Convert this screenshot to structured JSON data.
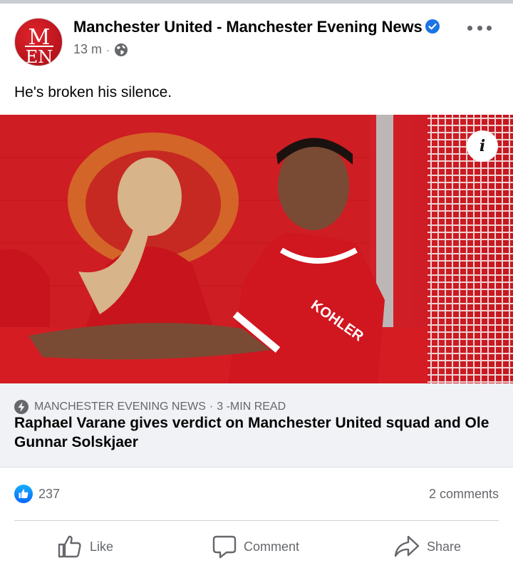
{
  "post": {
    "page_name": "Manchester United - Manchester Evening News",
    "avatar_letters": "MEN",
    "time": "13 m",
    "separator": "·",
    "privacy_icon": "globe-icon",
    "verified_icon": "verified-badge-icon",
    "more_icon": "more-options-icon",
    "text": "He's broken his silence."
  },
  "preview": {
    "info_icon": "info-icon",
    "info_glyph": "i",
    "source_icon": "instant-article-bolt-icon",
    "source": "MANCHESTER EVENING NEWS",
    "source_dot": "·",
    "read_time": "3 -MIN READ",
    "headline": "Raphael Varane gives verdict on Manchester United squad and Ole Gunnar Solskjaer",
    "image_text": {
      "shirt_sponsor": "KOHLER"
    }
  },
  "engagement": {
    "like_icon": "thumbs-up-icon",
    "likes": "237",
    "comments": "2 comments"
  },
  "actions": {
    "like_label": "Like",
    "comment_label": "Comment",
    "share_label": "Share"
  },
  "colors": {
    "brand_blue": "#0866ff",
    "secondary_text": "#65676b",
    "kit_red": "#d61a21"
  }
}
